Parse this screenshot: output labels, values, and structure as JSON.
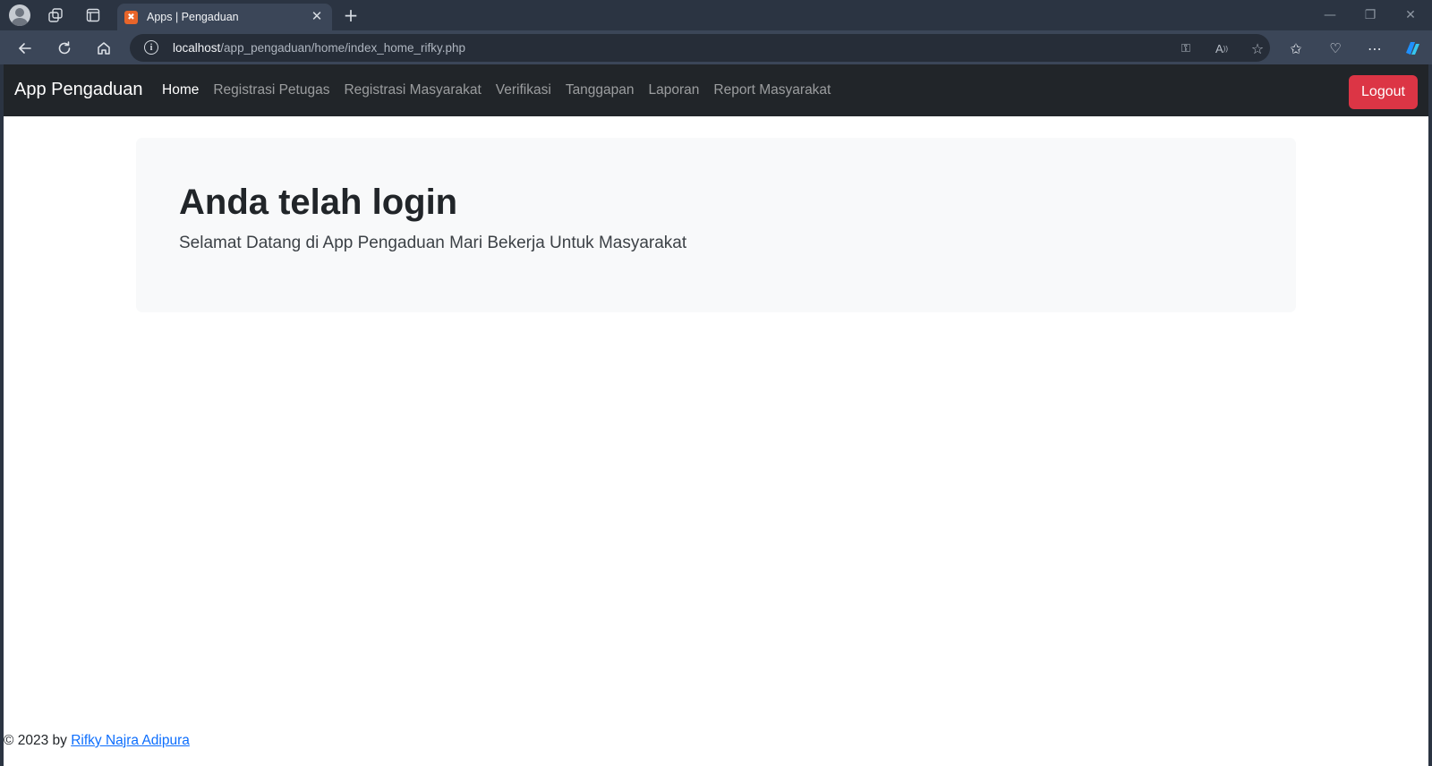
{
  "browser": {
    "tab_title": "Apps | Pengaduan",
    "favicon_glyph": "✖",
    "url_host": "localhost",
    "url_path": "/app_pengaduan/home/index_home_rifky.php"
  },
  "navbar": {
    "brand": "App Pengaduan",
    "links": [
      "Home",
      "Registrasi Petugas",
      "Registrasi Masyarakat",
      "Verifikasi",
      "Tanggapan",
      "Laporan",
      "Report Masyarakat"
    ],
    "logout_label": "Logout",
    "logout_color": "#dc3545"
  },
  "hero": {
    "title": "Anda telah login",
    "lead": "Selamat Datang di App Pengaduan Mari Bekerja Untuk Masyarakat"
  },
  "footer": {
    "prefix": "© 2023 by ",
    "author_link": "Rifky Najra Adipura"
  }
}
